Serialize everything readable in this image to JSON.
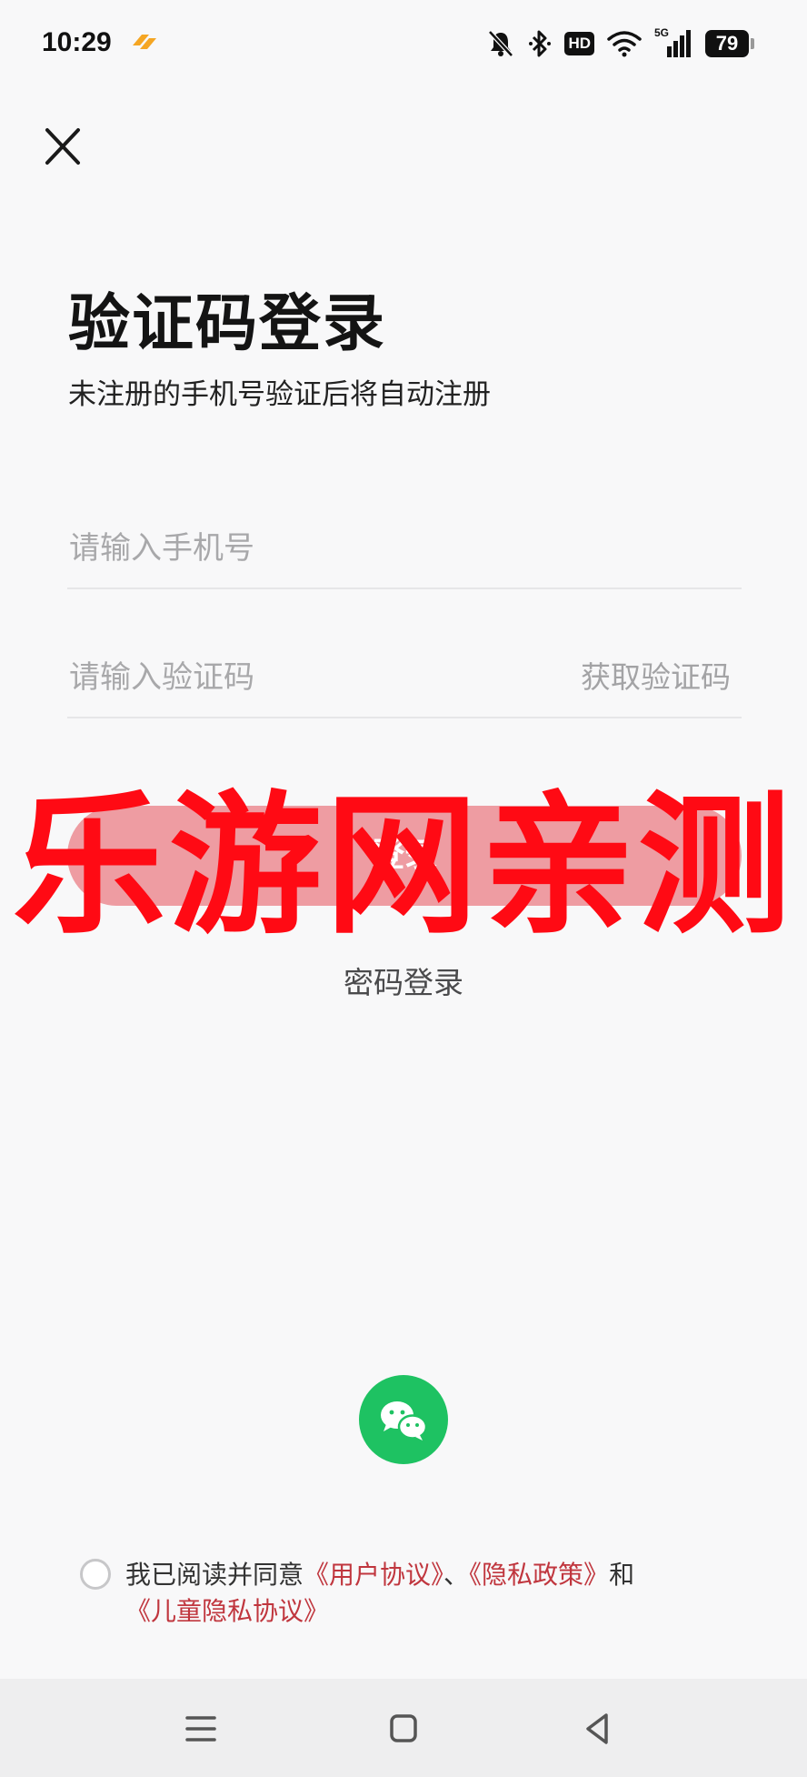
{
  "status_bar": {
    "time": "10:29",
    "hd_label": "HD",
    "network_label": "5G",
    "battery_level": "79",
    "icons": [
      "app-notification-icon",
      "bell-muted-icon",
      "bluetooth-icon",
      "wifi-icon",
      "cellular-signal-icon",
      "battery-icon"
    ]
  },
  "header": {
    "close_icon": "close-icon"
  },
  "login": {
    "title": "验证码登录",
    "subtitle": "未注册的手机号验证后将自动注册",
    "phone_placeholder": "请输入手机号",
    "code_placeholder": "请输入验证码",
    "get_code_label": "获取验证码",
    "login_button_label": "登录",
    "password_login_label": "密码登录"
  },
  "watermark": {
    "text": "乐游网亲测"
  },
  "third_party": {
    "wechat_icon": "wechat-icon",
    "brand_color": "#1ec262"
  },
  "agreement": {
    "prefix": "我已阅读并同意",
    "user_agreement": "《用户协议》",
    "separator": "、",
    "privacy_policy": "《隐私政策》",
    "and": "和",
    "child_privacy": "《儿童隐私协议》",
    "link_color": "#c0363e"
  },
  "nav_bar": {
    "icons": [
      "menu-icon",
      "home-icon",
      "back-icon"
    ]
  },
  "colors": {
    "accent": "#ee9ca2",
    "watermark": "#ff0a14",
    "background": "#f8f8f9"
  }
}
